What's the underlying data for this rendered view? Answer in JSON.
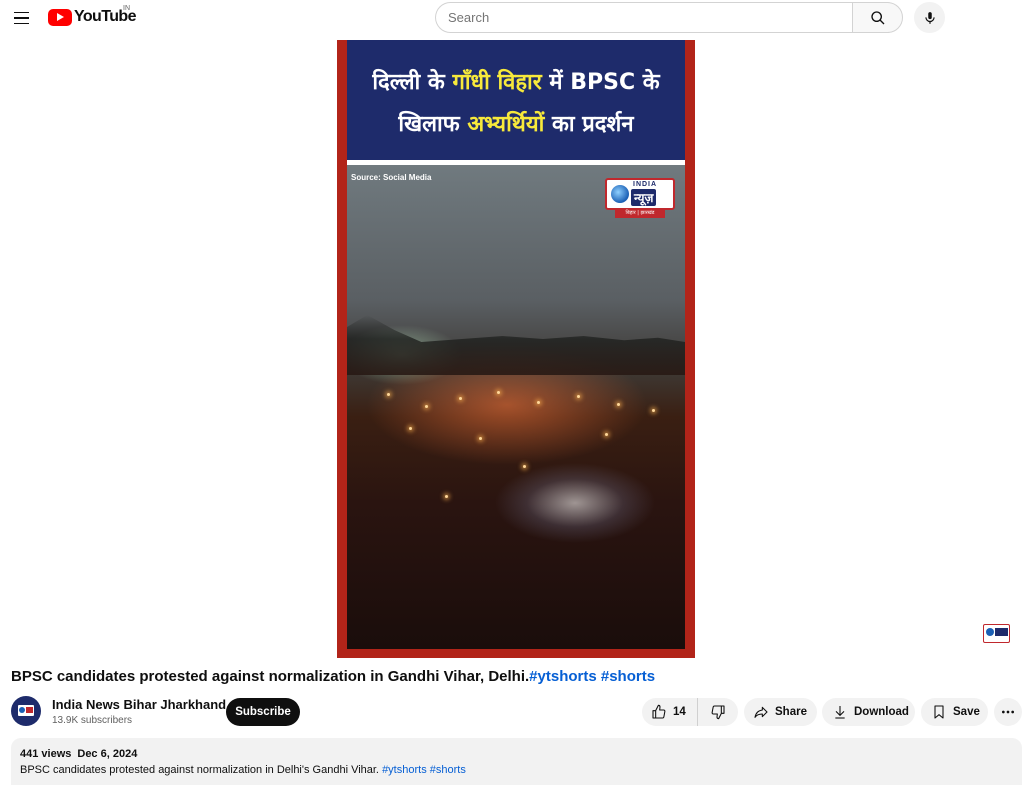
{
  "header": {
    "logo_text": "YouTube",
    "country_code": "IN",
    "search_placeholder": "Search"
  },
  "video": {
    "banner_line1_a": "दिल्ली के ",
    "banner_line1_hl": "गाँधी विहार",
    "banner_line1_b": " में BPSC के",
    "banner_line2_a": "खिलाफ ",
    "banner_line2_hl": "अभ्यर्थियों",
    "banner_line2_b": " का प्रदर्शन",
    "source_label": "Source: Social Media",
    "channel_logo_top": "INDIA",
    "channel_logo_main": "न्यूज़",
    "channel_logo_bottom": "बिहार | झारखंड"
  },
  "title": {
    "text": "BPSC candidates protested against normalization in Gandhi Vihar, Delhi.",
    "tag1": "#ytshorts",
    "tag2": "#shorts"
  },
  "channel": {
    "name": "India News Bihar Jharkhand",
    "subscribers": "13.9K subscribers",
    "subscribe_label": "Subscribe"
  },
  "actions": {
    "like_count": "14",
    "share_label": "Share",
    "download_label": "Download",
    "save_label": "Save"
  },
  "description": {
    "views": "441 views",
    "date": "Dec 6, 2024",
    "text": "BPSC candidates protested against normalization in Delhi's Gandhi Vihar.",
    "tag1": "#ytshorts",
    "tag2": "#shorts"
  }
}
